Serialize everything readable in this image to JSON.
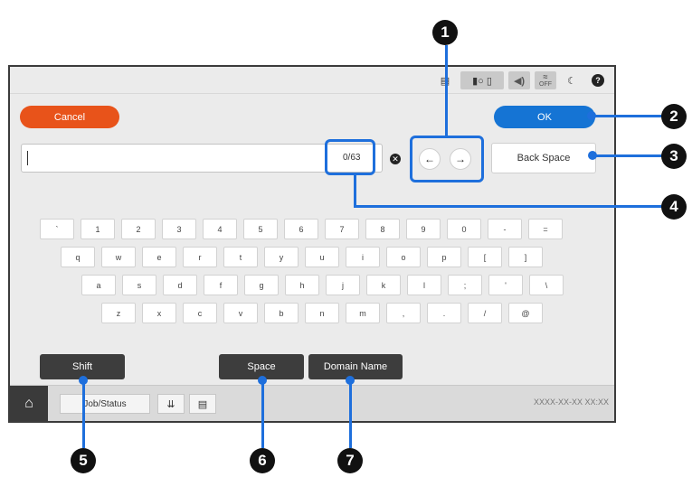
{
  "status_bar": {
    "icons": [
      "document-icon",
      "ink-icon",
      "paper-icon",
      "sound-icon",
      "wifi-off-icon",
      "sleep-icon",
      "help-icon"
    ],
    "wifi_off_label": "OFF"
  },
  "cancel_label": "Cancel",
  "ok_label": "OK",
  "input": {
    "value": "",
    "char_count": "0/63"
  },
  "back_space_label": "Back Space",
  "keyboard": {
    "row1": [
      "`",
      "1",
      "2",
      "3",
      "4",
      "5",
      "6",
      "7",
      "8",
      "9",
      "0",
      "-",
      "="
    ],
    "row2": [
      "q",
      "w",
      "e",
      "r",
      "t",
      "y",
      "u",
      "i",
      "o",
      "p",
      "[",
      "]"
    ],
    "row3": [
      "a",
      "s",
      "d",
      "f",
      "g",
      "h",
      "j",
      "k",
      "l",
      ";",
      "'",
      "\\"
    ],
    "row4": [
      "z",
      "x",
      "c",
      "v",
      "b",
      "n",
      "m",
      ",",
      ".",
      "/",
      "@"
    ]
  },
  "shift_label": "Shift",
  "space_label": "Space",
  "domain_name_label": "Domain Name",
  "bottom_bar": {
    "job_status_label": "Job/Status",
    "datetime": "XXXX-XX-XX XX:XX"
  },
  "callouts": [
    "1",
    "2",
    "3",
    "4",
    "5",
    "6",
    "7"
  ],
  "colors": {
    "cancel": "#e8531a",
    "ok": "#1574d4",
    "callout": "#1e6fdc",
    "dark_button": "#3d3d3d"
  }
}
